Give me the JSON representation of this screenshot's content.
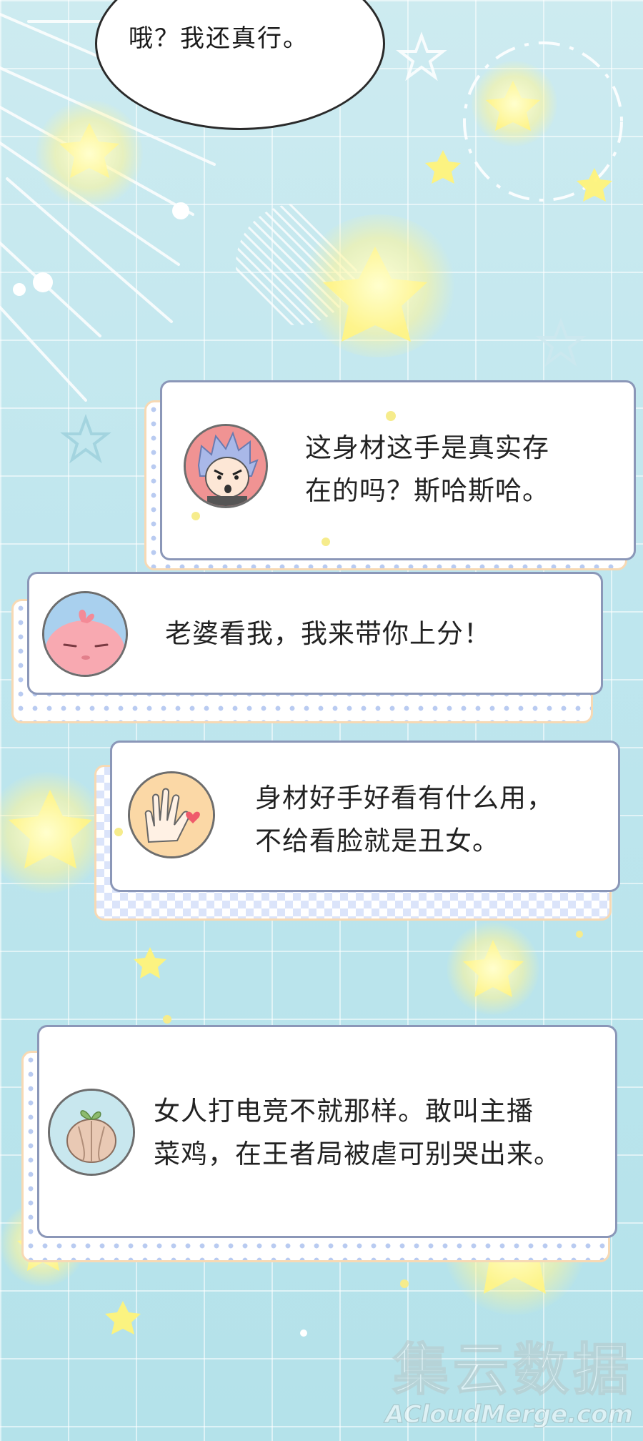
{
  "speech_bubble": {
    "text": "哦？我还真行。"
  },
  "messages": [
    {
      "line1": "这身材这手是真实存",
      "line2": "在的吗？斯哈斯哈。",
      "avatar": "spiky-hair-boy-avatar"
    },
    {
      "line1": "老婆看我，我来带你上分！",
      "line2": "",
      "avatar": "pink-blob-avatar"
    },
    {
      "line1": "身材好手好看有什么用，",
      "line2": "不给看脸就是丑女。",
      "avatar": "waving-hand-avatar"
    },
    {
      "line1": "女人打电竞不就那样。敢叫主播",
      "line2": "菜鸡，在王者局被虐可别哭出来。",
      "avatar": "steamed-bun-avatar"
    }
  ],
  "watermark": {
    "cn": "集云数据",
    "en": "ACloudMerge.com"
  },
  "colors": {
    "background": "#bfe6ee",
    "card_border": "#8b97b8",
    "shadow_dots": "#b9cbf1",
    "shadow_border": "#f7d9b4",
    "star": "#fff27a"
  }
}
